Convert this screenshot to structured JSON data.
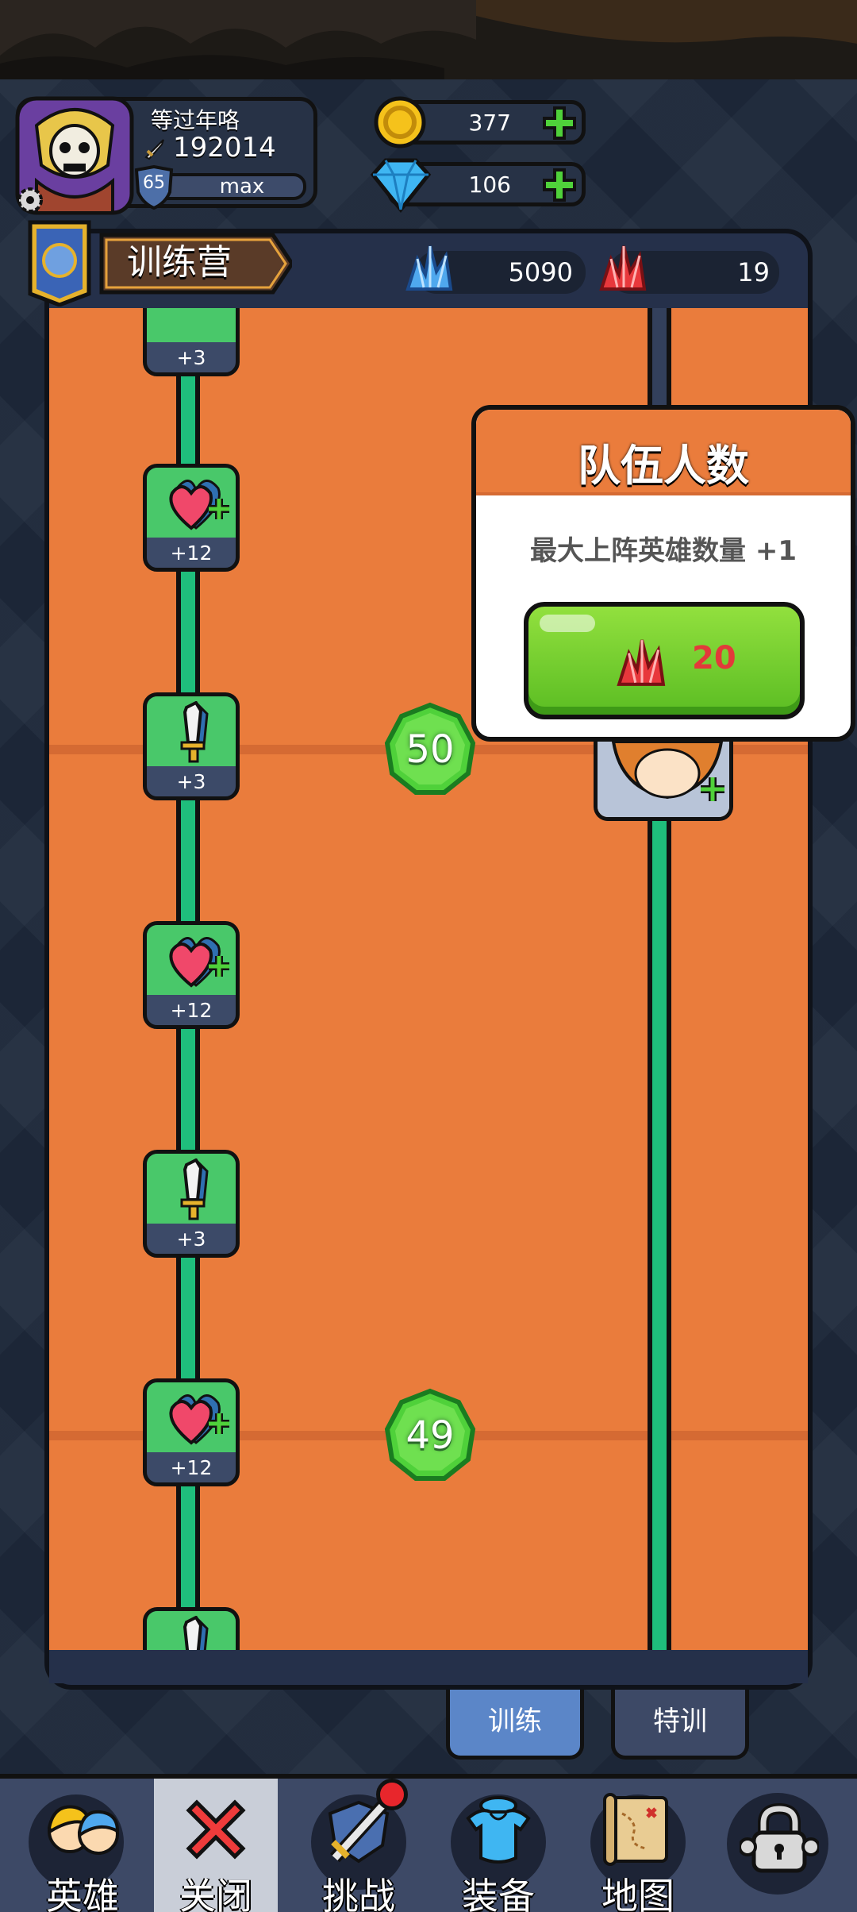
{
  "player": {
    "name": "等过年咯",
    "power": "192014",
    "level": "65",
    "level_status": "max"
  },
  "currencies": {
    "gold": "377",
    "diamond": "106"
  },
  "camp": {
    "title": "训练营",
    "blue_crystal": "5090",
    "red_crystal": "19"
  },
  "track_nodes": [
    {
      "type": "attack",
      "label": "+3"
    },
    {
      "type": "health",
      "label": "+12"
    },
    {
      "type": "attack",
      "label": "+3"
    },
    {
      "type": "health",
      "label": "+12"
    },
    {
      "type": "attack",
      "label": "+3"
    },
    {
      "type": "health",
      "label": "+12"
    },
    {
      "type": "attack",
      "label": ""
    }
  ],
  "level_markers": [
    "50",
    "49"
  ],
  "popup": {
    "title": "队伍人数",
    "description": "最大上阵英雄数量 +1",
    "cost": "20"
  },
  "tabs": {
    "train": "训练",
    "special": "特训"
  },
  "nav": {
    "heroes": "英雄",
    "close": "关闭",
    "challenge": "挑战",
    "equipment": "装备",
    "map": "地图"
  },
  "colors": {
    "panel_orange": "#ea7c3c",
    "track_green": "#1fbe7c",
    "node_green": "#49c86a",
    "button_green": "#6fcf2c",
    "cost_red": "#e23a3a"
  },
  "icons": [
    "gold-coin-icon",
    "diamond-icon",
    "plus-icon",
    "blue-crystal-icon",
    "red-crystal-icon",
    "sword-icon",
    "heart-plus-icon",
    "shield-badge-icon",
    "close-x-icon",
    "lock-icon",
    "map-scroll-icon",
    "armor-icon",
    "settings-gear-icon"
  ]
}
